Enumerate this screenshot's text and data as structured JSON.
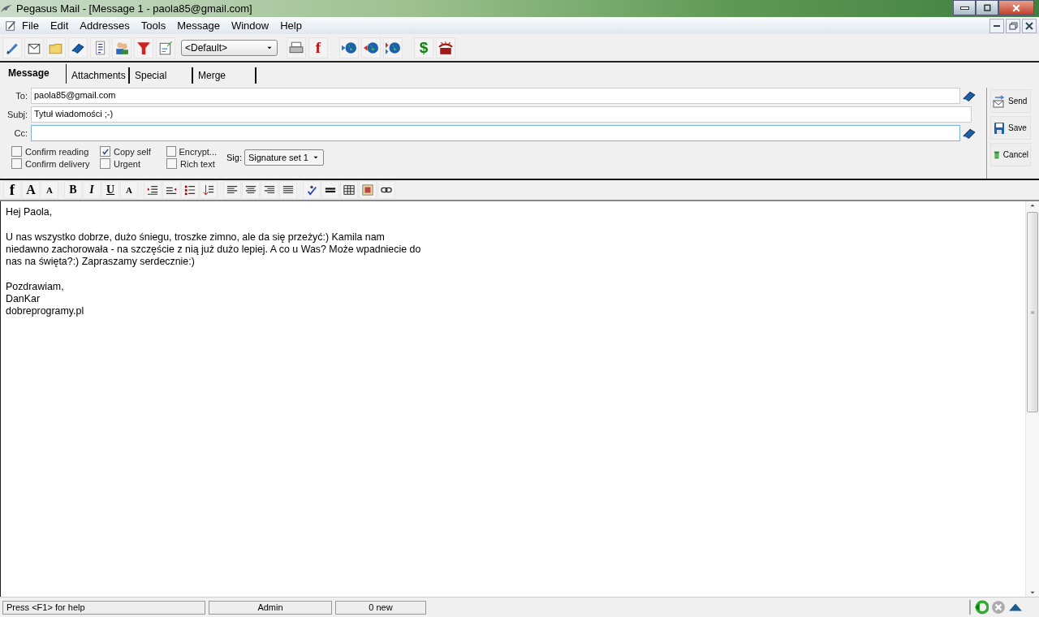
{
  "window": {
    "title": "Pegasus Mail - [Message 1 - paola85@gmail.com]"
  },
  "menu": [
    "File",
    "Edit",
    "Addresses",
    "Tools",
    "Message",
    "Window",
    "Help"
  ],
  "toolbar": {
    "identity": "<Default>",
    "glyph_f": "f",
    "glyph_dollar": "$"
  },
  "tabs": [
    {
      "label": "Message",
      "selected": true
    },
    {
      "label": "Attachments",
      "selected": false
    },
    {
      "label": "Special",
      "selected": false
    },
    {
      "label": "Merge",
      "selected": false
    }
  ],
  "fields": [
    {
      "label": "To:",
      "value": "paola85@gmail.com",
      "book": true
    },
    {
      "label": "Subj:",
      "value": "Tytuł wiadomości ;-)",
      "book": false
    },
    {
      "label": "Cc:",
      "book": true,
      "focused": true
    }
  ],
  "options": [
    {
      "label": "Confirm reading",
      "checked": false
    },
    {
      "label": "Confirm delivery",
      "checked": false
    },
    {
      "label": "Copy self",
      "checked": true
    },
    {
      "label": "Urgent",
      "checked": false
    },
    {
      "label": "Encrypt...",
      "checked": false
    },
    {
      "label": "Rich text",
      "checked": false
    }
  ],
  "signature": {
    "label": "Sig:",
    "value": "Signature set 1"
  },
  "actions": [
    "Send",
    "Save",
    "Cancel"
  ],
  "format_glyphs": [
    "f",
    "A",
    "A",
    "B",
    "I",
    "U",
    "A"
  ],
  "body": [
    [
      "Hej Paola,"
    ],
    [
      "U nas wszystko dobrze, dużo śniegu, troszke zimno, ale da się przeżyć:) Kamila nam",
      "niedawno zachorowała - na szczęście z nią już dużo lepiej. A co u Was? Może wpadniecie do",
      "nas na święta?:) Zapraszamy serdecznie:)"
    ],
    [
      "Pozdrawiam,",
      "DanKar",
      "dobreprogramy.pl"
    ]
  ],
  "status_bar": [
    "Press <F1> for help",
    "Admin",
    "0 new"
  ]
}
